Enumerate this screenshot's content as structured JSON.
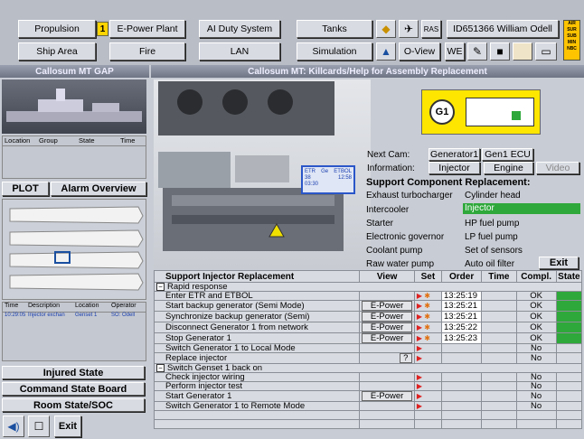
{
  "topbar": {
    "row1": [
      "Propulsion",
      "E-Power Plant",
      "AI Duty System",
      "Tanks"
    ],
    "row1_tag": "1",
    "ras": "RAS",
    "user": "ID651366 William Odell",
    "row2": [
      "Ship Area",
      "Fire",
      "LAN",
      "Simulation"
    ],
    "oview": "O-View",
    "we": "WE",
    "sensor_lines": [
      "AIR",
      "SUR",
      "SUB",
      "MIN",
      "NBC"
    ]
  },
  "left": {
    "header": "Callosum MT GAP",
    "event_cols": [
      "Location",
      "Group",
      "State",
      "Time"
    ],
    "plot_button": "PLOT",
    "alarm_button": "Alarm Overview",
    "log_cols": [
      "Time",
      "Description",
      "Location",
      "Operator"
    ],
    "log_row": {
      "time": "10:29:05",
      "description": "Injector exchan",
      "location": "Genset 1",
      "operator": "SO: Odell"
    },
    "state_buttons": [
      "Injured State",
      "Command State Board",
      "Room State/SOC"
    ],
    "exit": "Exit"
  },
  "main": {
    "header": "Callosum MT: Killcards/Help for Assembly Replacement",
    "g1_label": "G1",
    "engine_callout": {
      "etr": "ETR",
      "etr_val": "38",
      "ge": "Ge",
      "etbol": "ETBOL",
      "etbol_val": "12:58",
      "small": "03:30"
    },
    "next_cam_label": "Next Cam:",
    "next_cam_buttons": [
      "Generator1",
      "Gen1 ECU"
    ],
    "information_label": "Information:",
    "info_buttons": [
      "Injector",
      "Engine",
      "Video"
    ],
    "support_title": "Support Component Replacement:",
    "components": [
      [
        "Exhaust turbocharger",
        "Cylinder head"
      ],
      [
        "Intercooler",
        "Injector"
      ],
      [
        "Starter",
        "HP fuel pump"
      ],
      [
        "Electronic governor",
        "LP fuel pump"
      ],
      [
        "Coolant pump",
        "Set of sensors"
      ],
      [
        "Raw water pump",
        "Auto oil filter"
      ]
    ],
    "exit": "Exit",
    "table": {
      "headers": [
        "Support Injector Replacement",
        "View",
        "Set",
        "Order",
        "Time",
        "Compl.",
        "State"
      ],
      "rows": [
        {
          "type": "group",
          "text": "Rapid response"
        },
        {
          "text": "Enter ETR and ETBOL",
          "view": "",
          "set": "arrow-star",
          "order": "13:25:19",
          "compl": "OK",
          "state": "green"
        },
        {
          "text": "Start backup generator (Semi Mode)",
          "view": "E-Power",
          "set": "arrow-star",
          "order": "13:25:21",
          "compl": "OK",
          "state": "green"
        },
        {
          "text": "Synchronize backup generator (Semi)",
          "view": "E-Power",
          "set": "arrow-star",
          "order": "13:25:21",
          "compl": "OK",
          "state": "green"
        },
        {
          "text": "Disconnect Generator 1 from network",
          "view": "E-Power",
          "set": "arrow-star",
          "order": "13:25:22",
          "compl": "OK",
          "state": "green"
        },
        {
          "text": "Stop Generator 1",
          "view": "E-Power",
          "set": "arrow-star",
          "order": "13:25:23",
          "compl": "OK",
          "state": "green"
        },
        {
          "text": "Switch Generator 1 to Local Mode",
          "view": "",
          "set": "arrow",
          "order": "",
          "compl": "No",
          "state": ""
        },
        {
          "text": "Replace injector",
          "view": "?",
          "set": "arrow",
          "order": "",
          "compl": "No",
          "state": ""
        },
        {
          "type": "group",
          "text": "Switch Genset 1 back on"
        },
        {
          "text": "Check injector wiring",
          "view": "",
          "set": "arrow",
          "order": "",
          "compl": "No",
          "state": ""
        },
        {
          "text": "Perform injector test",
          "view": "",
          "set": "arrow",
          "order": "",
          "compl": "No",
          "state": ""
        },
        {
          "text": "Start Generator 1",
          "view": "E-Power",
          "set": "arrow",
          "order": "",
          "compl": "No",
          "state": ""
        },
        {
          "text": "Switch Generator 1 to Remote Mode",
          "view": "",
          "set": "arrow",
          "order": "",
          "compl": "No",
          "state": ""
        }
      ]
    }
  }
}
